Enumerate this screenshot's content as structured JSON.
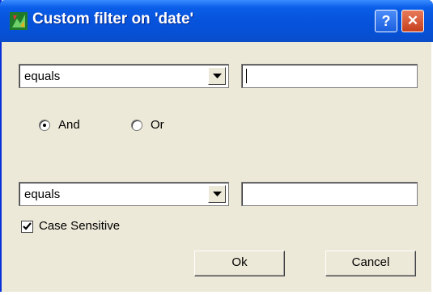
{
  "window": {
    "title": "Custom filter on 'date'",
    "help_label": "?",
    "close_label": "✕"
  },
  "condition1": {
    "operator": "equals",
    "value": ""
  },
  "logic": {
    "and_label": "And",
    "or_label": "Or",
    "selected": "And"
  },
  "condition2": {
    "operator": "equals",
    "value": ""
  },
  "case_sensitive": {
    "label": "Case Sensitive",
    "checked": true
  },
  "buttons": {
    "ok_label": "Ok",
    "cancel_label": "Cancel"
  },
  "colors": {
    "titlebar": "#0753dc",
    "body": "#ece9d8",
    "close": "#c6401e"
  },
  "icons": {
    "title": "app-icon",
    "help": "help-icon",
    "close": "close-icon",
    "dropdown": "chevron-down-icon",
    "check": "checkmark-icon"
  }
}
